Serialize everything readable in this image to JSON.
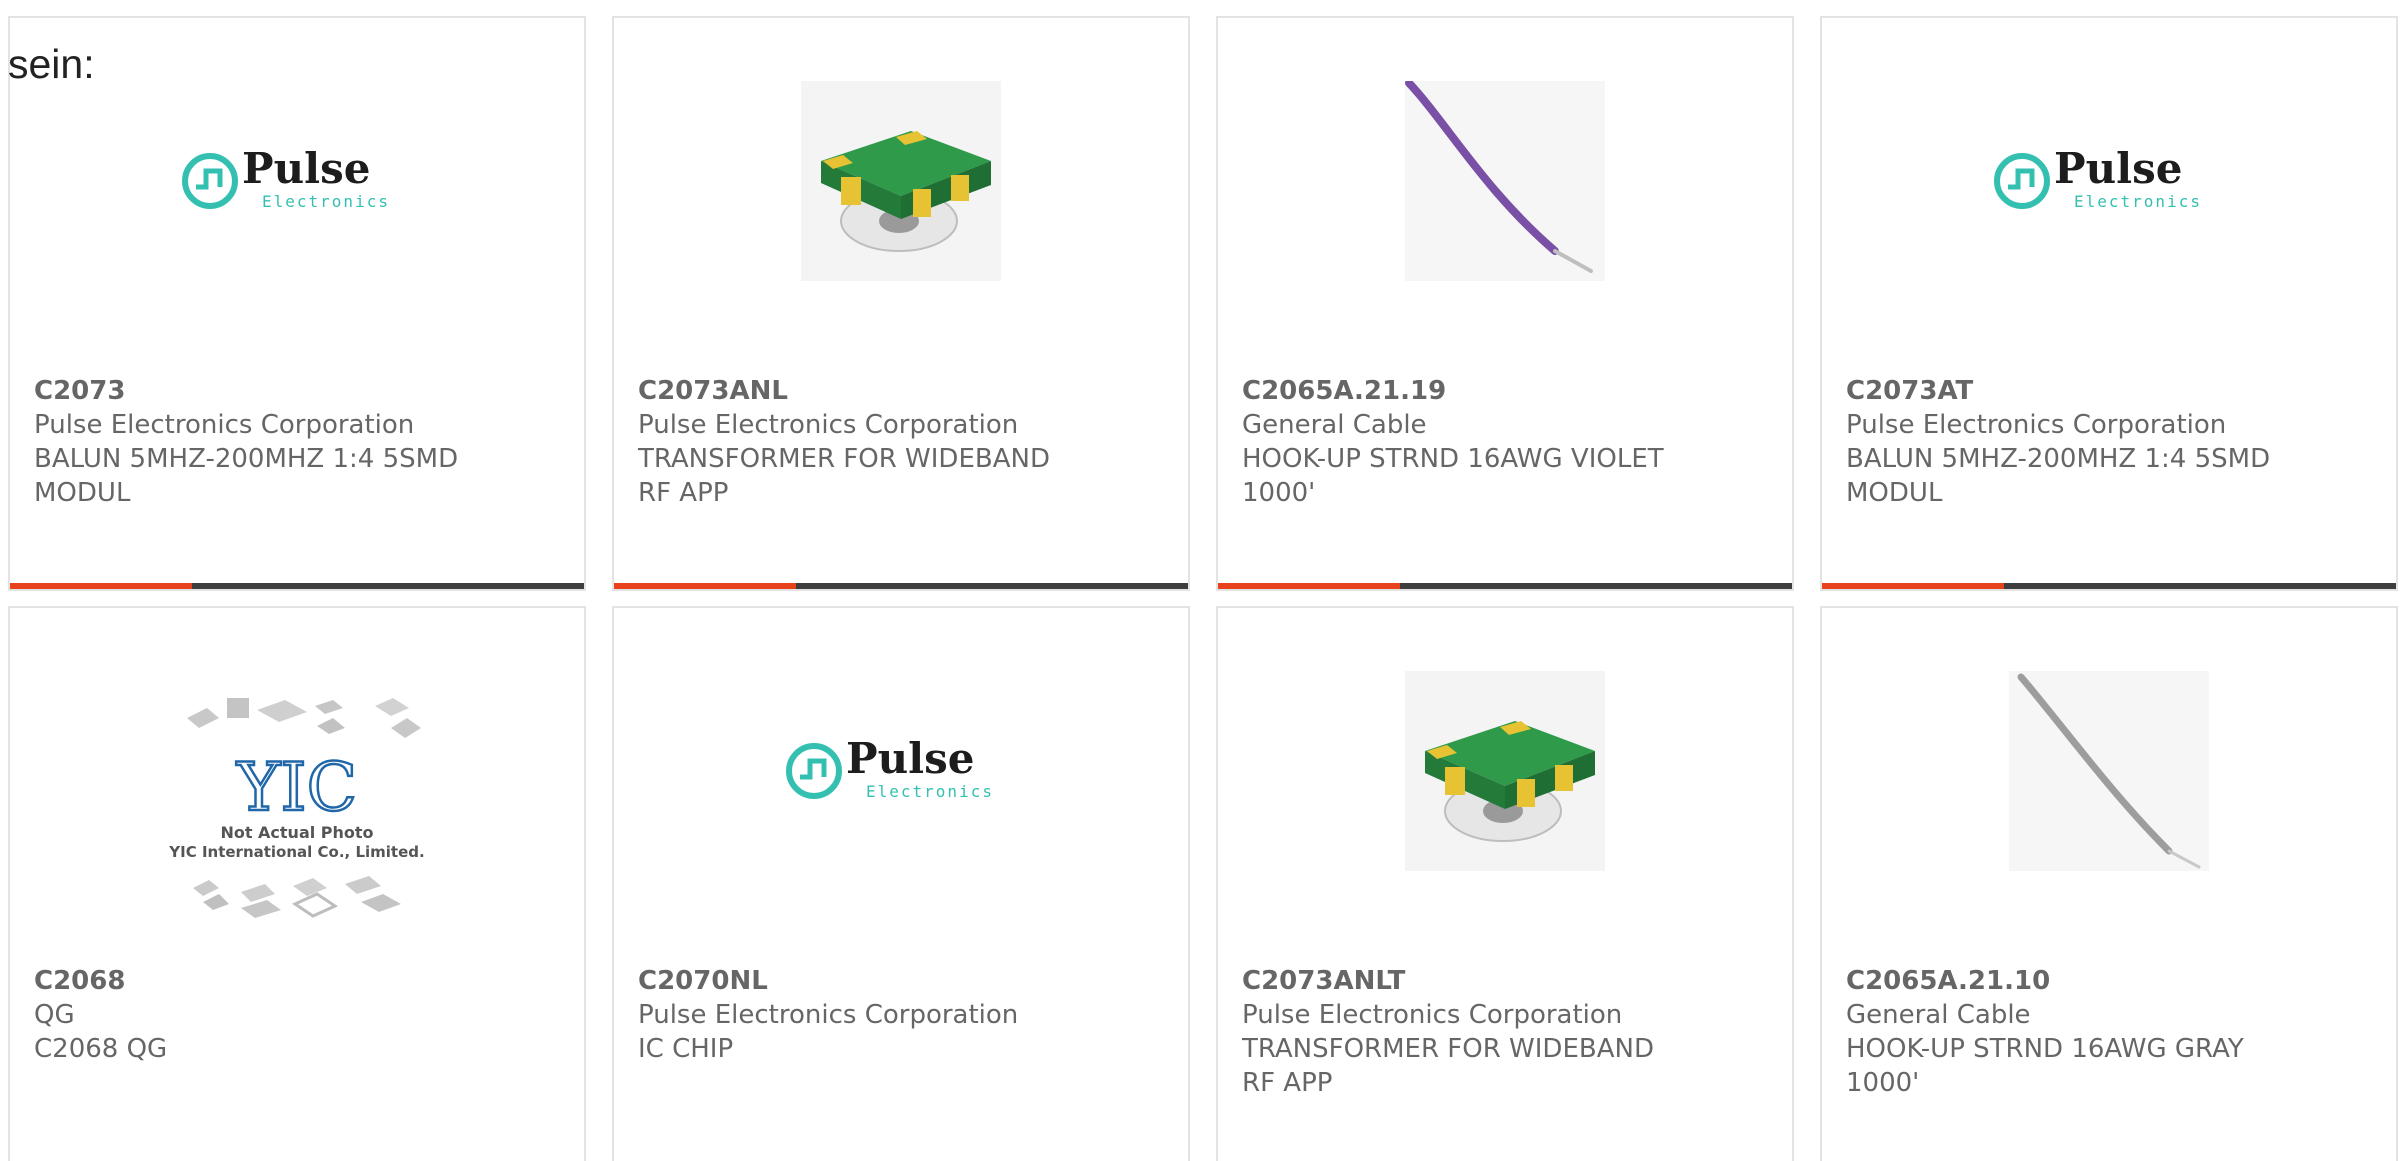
{
  "intro_text": "sein:",
  "colors": {
    "accent": "#e8411c",
    "bar": "#3d3d3d",
    "border": "#e3e3e3",
    "text": "#666666",
    "pulse_teal": "#34c0b0"
  },
  "products": [
    {
      "part": "C2073",
      "maker": "Pulse Electronics Corporation",
      "desc": "BALUN 5MHZ-200MHZ 1:4 5SMD MODUL",
      "image": "pulse-logo",
      "logo": {
        "brand": "Pulse",
        "sub": "Electronics"
      }
    },
    {
      "part": "C2073ANL",
      "maker": "Pulse Electronics Corporation",
      "desc": "TRANSFORMER FOR WIDEBAND RF APP",
      "image": "smd-transformer"
    },
    {
      "part": "C2065A.21.19",
      "maker": "General Cable",
      "desc": "HOOK-UP STRND 16AWG VIOLET 1000'",
      "image": "violet-wire"
    },
    {
      "part": "C2073AT",
      "maker": "Pulse Electronics Corporation",
      "desc": "BALUN 5MHZ-200MHZ 1:4 5SMD MODUL",
      "image": "pulse-logo",
      "logo": {
        "brand": "Pulse",
        "sub": "Electronics"
      }
    },
    {
      "part": "C2068",
      "maker": "QG",
      "desc": "C2068 QG",
      "image": "yic-placeholder",
      "placeholder": {
        "mark": "YIC",
        "line1": "Not Actual Photo",
        "line2": "YIC International Co., Limited."
      }
    },
    {
      "part": "C2070NL",
      "maker": "Pulse Electronics Corporation",
      "desc": "IC CHIP",
      "image": "pulse-logo",
      "logo": {
        "brand": "Pulse",
        "sub": "Electronics"
      }
    },
    {
      "part": "C2073ANLT",
      "maker": "Pulse Electronics Corporation",
      "desc": "TRANSFORMER FOR WIDEBAND RF APP",
      "image": "smd-transformer"
    },
    {
      "part": "C2065A.21.10",
      "maker": "General Cable",
      "desc": "HOOK-UP STRND 16AWG GRAY 1000'",
      "image": "gray-wire"
    }
  ]
}
